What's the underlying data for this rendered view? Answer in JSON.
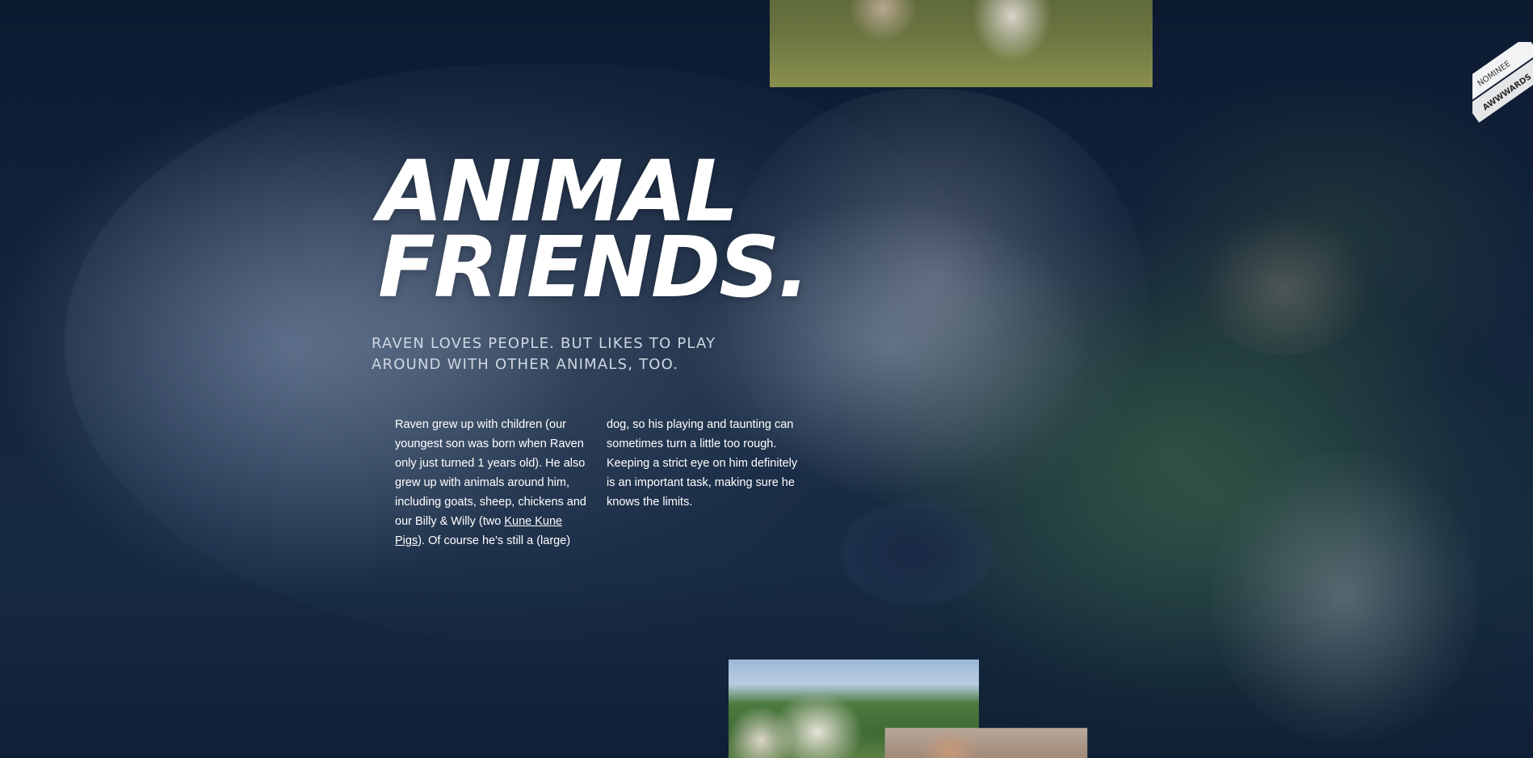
{
  "hero": {
    "headline_line1": "ANIMAL",
    "headline_line2": "FRIENDS.",
    "subtitle": "RAVEN LOVES PEOPLE. BUT LIKES TO PLAY AROUND WITH OTHER ANIMALS, TOO.",
    "body_before_link": "Raven grew up with children (our youngest son was born when Raven only just turned 1 years old). He also grew up with animals around him, including goats, sheep, chickens and our Billy & Willy (two ",
    "body_link": "Kune Kune Pigs",
    "body_after_link": "). Of course he's still a (large) dog, so his playing and taunting can sometimes turn a little too rough. Keeping a strict eye on him definitely is an important task, making sure he knows the limits."
  },
  "ribbon": {
    "top_text": "NOMINEE",
    "bottom_text": "AWWWARDS"
  },
  "colors": {
    "background": "#0f1f35",
    "headline": "#ffffff",
    "subtitle": "#cfd7e2"
  }
}
